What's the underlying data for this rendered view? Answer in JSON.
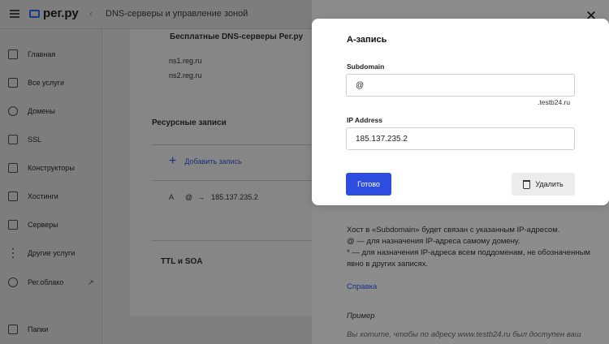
{
  "header": {
    "logo": "рег.ру",
    "back": "‹",
    "breadcrumb": "DNS-серверы и управление зоной"
  },
  "sidebar": {
    "items": [
      {
        "label": "Главная",
        "icon": "home-icon"
      },
      {
        "label": "Все услуги",
        "icon": "list-icon"
      },
      {
        "label": "Домены",
        "icon": "globe-icon"
      },
      {
        "label": "SSL",
        "icon": "lock-icon"
      },
      {
        "label": "Конструкторы",
        "icon": "window-icon"
      },
      {
        "label": "Хостинги",
        "icon": "server-icon"
      },
      {
        "label": "Серверы",
        "icon": "server-rack-icon"
      },
      {
        "label": "Другие услуги",
        "icon": "more-vertical-icon"
      },
      {
        "label": "Рег.облако",
        "icon": "cloud-icon"
      },
      {
        "label": "Папки",
        "icon": "folder-icon"
      }
    ],
    "external_glyph": "↗"
  },
  "content": {
    "free_dns_title": "Бесплатные DNS-серверы Рег.ру",
    "ns1": "ns1.reg.ru",
    "ns2": "ns2.reg.ru",
    "resource_records_title": "Ресурсные записи",
    "add_record": "Добавить запись",
    "record": {
      "type": "A",
      "host": "@",
      "arrow": "→",
      "value": "185.137.235.2"
    },
    "ttl_soa": "TTL и SOA"
  },
  "modal": {
    "title": "А-запись",
    "subdomain_label": "Subdomain",
    "subdomain_value": "@",
    "subdomain_suffix": ".testb24.ru",
    "ip_label": "IP Address",
    "ip_value": "185.137.235.2",
    "done_button": "Готово",
    "delete_button": "Удалить"
  },
  "panel": {
    "info_line1": "Хост в «Subdomain» будет связан с указанным IP-адресом.",
    "info_line2": "@ — для назначения IP-адреса самому домену.",
    "info_line3": "* — для назначения IP-адреса всем поддоменам, не обозначенным явно в других записях.",
    "help_link": "Справка",
    "example_title": "Пример",
    "example_text": "Вы хотите, чтобы по адресу www.testb24.ru был доступен ваш"
  },
  "close_glyph": "✕"
}
